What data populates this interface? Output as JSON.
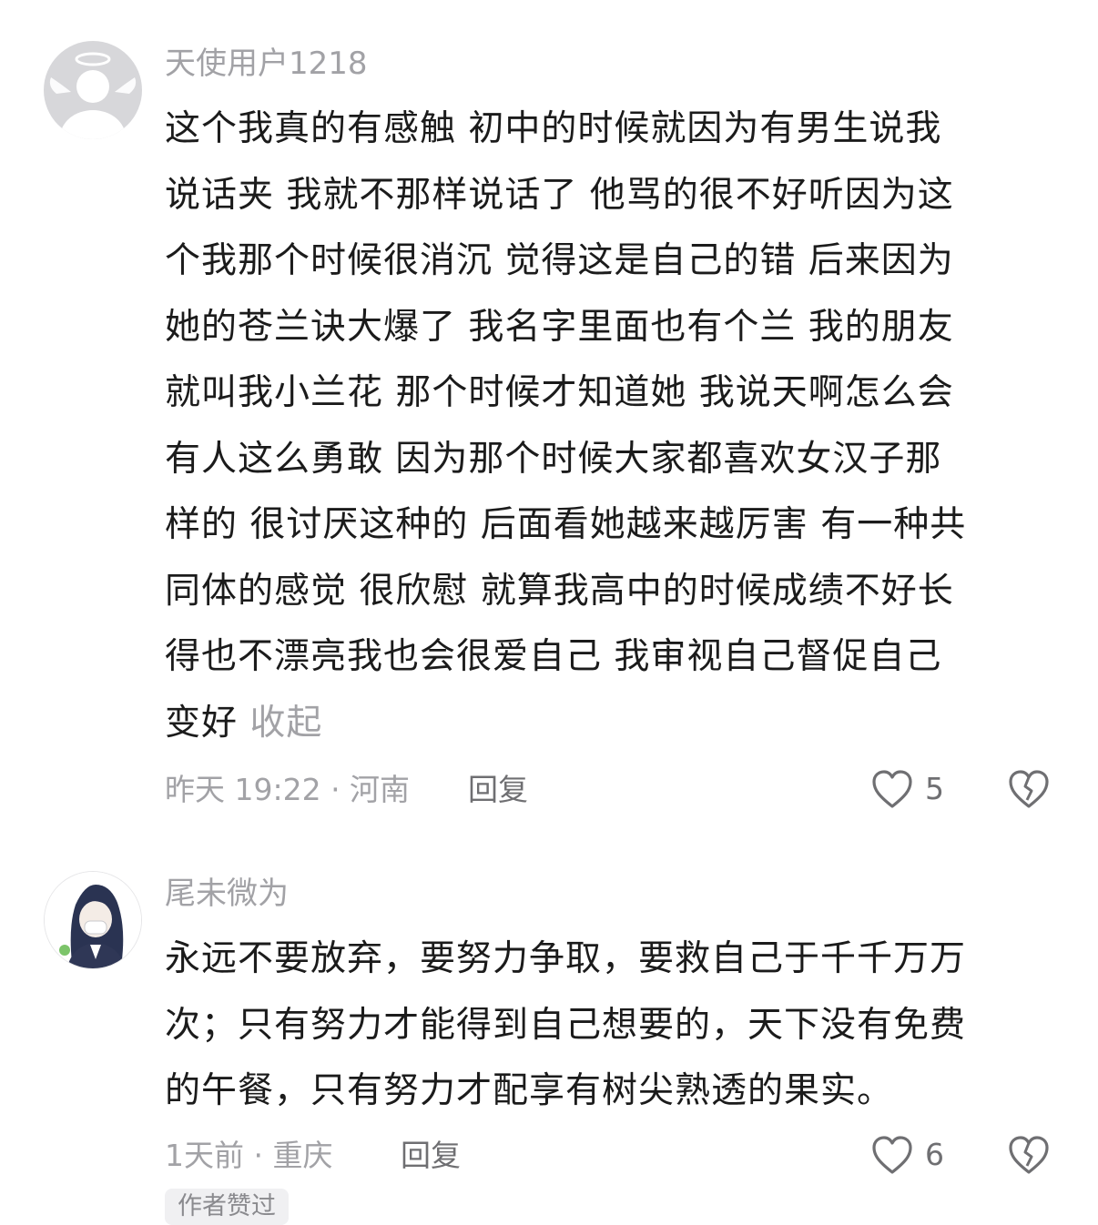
{
  "comments": [
    {
      "username": "天使用户1218",
      "avatar": "angel-avatar-icon",
      "lines": [
        "这个我真的有感触 初中的时候就因为有男生说我",
        "说话夹 我就不那样说话了 他骂的很不好听因为这",
        "个我那个时候很消沉 觉得这是自己的错 后来因为",
        "她的苍兰诀大爆了 我名字里面也有个兰 我的朋友",
        "就叫我小兰花 那个时候才知道她 我说天啊怎么会",
        "有人这么勇敢 因为那个时候大家都喜欢女汉子那",
        "样的 很讨厌这种的 后面看她越来越厉害 有一种共",
        "同体的感觉 很欣慰 就算我高中的时候成绩不好长",
        "得也不漂亮我也会很爱自己  我审视自己督促自己",
        "变好"
      ],
      "collapse_label": "收起",
      "meta": "昨天 19:22 · 河南",
      "reply_label": "回复",
      "like_count": "5"
    },
    {
      "username": "尾未微为",
      "avatar": "anime-girl-avatar",
      "lines": [
        "永远不要放弃，要努力争取，要救自己于千千万万",
        "次；只有努力才能得到自己想要的，天下没有免费",
        "的午餐，只有努力才配享有树尖熟透的果实。"
      ],
      "meta": "1天前 · 重庆",
      "reply_label": "回复",
      "like_count": "6",
      "badge": "作者赞过"
    }
  ]
}
